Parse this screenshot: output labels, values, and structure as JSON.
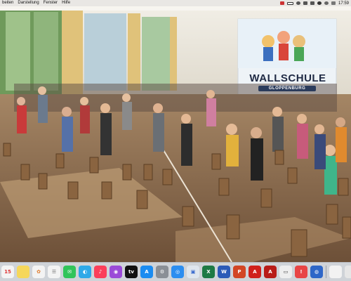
{
  "menubar": {
    "items": [
      "beiten",
      "Darstellung",
      "Fenster",
      "Hilfe"
    ],
    "clock": "17:59",
    "status_icons": [
      "flag-icon",
      "battery-icon",
      "bluetooth-icon",
      "audio-icon",
      "network-icon",
      "wifi-icon",
      "search-icon",
      "control-center-icon"
    ]
  },
  "photo": {
    "banner_title": "WALLSCHULE",
    "banner_subtitle": "GLOPPENBURG"
  },
  "dock": {
    "apps": [
      {
        "name": "calendar-icon",
        "glyph": "15",
        "color": "#f4f4f4",
        "fg": "#d33"
      },
      {
        "name": "notes-icon",
        "glyph": "",
        "color": "#f6d75a",
        "fg": "#333"
      },
      {
        "name": "photos-icon",
        "glyph": "✿",
        "color": "#f3f3f3",
        "fg": "#e07a2a"
      },
      {
        "name": "reminders-icon",
        "glyph": "☰",
        "color": "#f3f3f3",
        "fg": "#777"
      },
      {
        "name": "messages-icon",
        "glyph": "✉",
        "color": "#31c45a",
        "fg": "#fff"
      },
      {
        "name": "facetime-icon",
        "glyph": "◐",
        "color": "#2ea9e8",
        "fg": "#fff"
      },
      {
        "name": "music-icon",
        "glyph": "♪",
        "color": "#fb3f5a",
        "fg": "#fff"
      },
      {
        "name": "podcasts-icon",
        "glyph": "◉",
        "color": "#9b4ad8",
        "fg": "#fff"
      },
      {
        "name": "apple-tv-icon",
        "glyph": "tv",
        "color": "#111",
        "fg": "#fff"
      },
      {
        "name": "app-store-icon",
        "glyph": "A",
        "color": "#1b8cf1",
        "fg": "#fff"
      },
      {
        "name": "system-preferences-icon",
        "glyph": "⚙",
        "color": "#8a8f96",
        "fg": "#fff"
      },
      {
        "name": "safari-icon",
        "glyph": "◎",
        "color": "#2c8ef0",
        "fg": "#fff"
      },
      {
        "name": "preview-icon",
        "glyph": "▣",
        "color": "#dfe6ee",
        "fg": "#36c"
      },
      {
        "name": "excel-icon",
        "glyph": "X",
        "color": "#1e7a45",
        "fg": "#fff"
      },
      {
        "name": "word-icon",
        "glyph": "W",
        "color": "#2b5bb8",
        "fg": "#fff"
      },
      {
        "name": "powerpoint-icon",
        "glyph": "P",
        "color": "#d24625",
        "fg": "#fff"
      },
      {
        "name": "acrobat-icon",
        "glyph": "A",
        "color": "#d0201b",
        "fg": "#fff"
      },
      {
        "name": "acrobat-reader-icon",
        "glyph": "A",
        "color": "#b81c18",
        "fg": "#fff"
      },
      {
        "name": "keyboard-app-icon",
        "glyph": "▭",
        "color": "#eeeeee",
        "fg": "#333"
      },
      {
        "name": "red-app-icon",
        "glyph": "!",
        "color": "#e84545",
        "fg": "#fff"
      },
      {
        "name": "blue-app-icon",
        "glyph": "◍",
        "color": "#2e67c8",
        "fg": "#fff"
      },
      {
        "name": "downloads-icon",
        "glyph": "",
        "color": "#f2f2f2",
        "fg": "#333"
      },
      {
        "name": "trash-icon",
        "glyph": "",
        "color": "#e6e6e6",
        "fg": "#333"
      }
    ]
  }
}
